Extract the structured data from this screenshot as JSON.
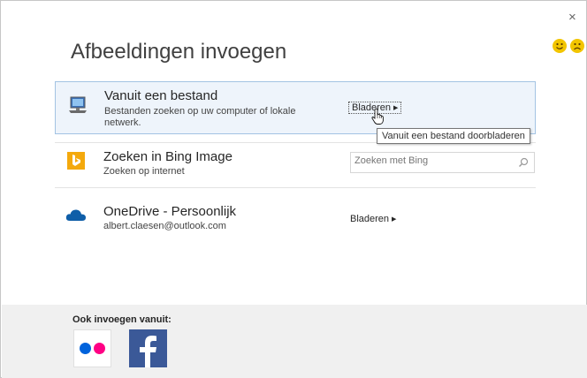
{
  "dialog": {
    "title": "Afbeeldingen invoegen",
    "close_symbol": "×",
    "feedback": [
      {
        "icon": "smiley-happy-icon",
        "color": "#f2c500"
      },
      {
        "icon": "smiley-sad-icon",
        "color": "#f2c500"
      }
    ]
  },
  "sources": [
    {
      "title": "Vanuit een bestand",
      "subtitle": "Bestanden zoeken op uw computer of lokale netwerk.",
      "icon": "computer-icon",
      "action": "Bladeren",
      "tooltip": "Vanuit een bestand doorbladeren"
    },
    {
      "title": "Zoeken in Bing Image",
      "subtitle": "Zoeken op internet",
      "icon": "bing-icon",
      "search_placeholder": "Zoeken met Bing",
      "search_icon": "search-icon"
    },
    {
      "title": "OneDrive - Persoonlijk",
      "subtitle": "albert.claesen@outlook.com",
      "icon": "onedrive-icon",
      "action": "Bladeren"
    }
  ],
  "footer": {
    "label": "Ook invoegen vanuit:",
    "services": [
      {
        "name": "flickr",
        "icon": "flickr-icon",
        "colors": [
          "#0063dc",
          "#ff0084"
        ]
      },
      {
        "name": "facebook",
        "icon": "facebook-icon",
        "color": "#3b5998"
      }
    ]
  },
  "colors": {
    "selection_bg": "#eef4fb",
    "selection_border": "#a3c3e3",
    "footer_bg": "#f0f0f0",
    "bing": "#f4a90d",
    "onedrive": "#0f5ea8"
  }
}
